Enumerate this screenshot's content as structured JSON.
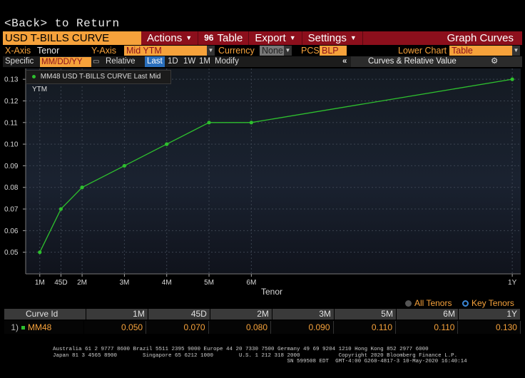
{
  "back_text": "<Back> to Return",
  "menubar": {
    "title": "USD T-BILLS CURVE",
    "actions": "Actions",
    "table_icon": "96",
    "table": "Table",
    "export": "Export",
    "settings": "Settings",
    "graph_curves": "Graph Curves"
  },
  "axisbar": {
    "x_axis_label": "X-Axis",
    "x_axis_value": "Tenor",
    "y_axis_label": "Y-Axis",
    "y_axis_value": "Mid YTM",
    "currency_label": "Currency",
    "currency_value": "None",
    "pcs_label": "PCS",
    "pcs_value": "BLP",
    "lower_chart_label": "Lower Chart",
    "lower_chart_value": "Table"
  },
  "specbar": {
    "specific_label": "Specific",
    "date_placeholder": "MM/DD/YY",
    "relative_label": "Relative",
    "tabs": [
      "Last",
      "1D",
      "1W",
      "1M"
    ],
    "modify": "Modify",
    "collapse": "«",
    "curves_panel": "Curves & Relative Value",
    "gear": "⚙"
  },
  "legend": "MM48 USD T-BILLS CURVE Last Mid YTM",
  "chart_data": {
    "type": "line",
    "categories": [
      "1M",
      "45D",
      "2M",
      "3M",
      "4M",
      "5M",
      "6M",
      "1Y"
    ],
    "x_days": [
      30,
      45,
      60,
      90,
      120,
      150,
      180,
      365
    ],
    "series": [
      {
        "name": "MM48 USD T-BILLS CURVE Last Mid YTM",
        "values": [
          0.05,
          0.07,
          0.08,
          0.09,
          0.1,
          0.11,
          0.11,
          0.13
        ],
        "color": "#2ec02e"
      }
    ],
    "xlabel": "Tenor",
    "ylabel": "",
    "ylim": [
      0.04,
      0.135
    ],
    "yticks": [
      "0.05",
      "0.06",
      "0.07",
      "0.08",
      "0.09",
      "0.10",
      "0.11",
      "0.12",
      "0.13"
    ],
    "grid": true,
    "legend_position": "top-left"
  },
  "tenor_toggle": {
    "all": "All Tenors",
    "key": "Key Tenors"
  },
  "table": {
    "headers": [
      "Curve Id",
      "1M",
      "45D",
      "2M",
      "3M",
      "5M",
      "6M",
      "1Y"
    ],
    "row": {
      "index": "1)",
      "curve": "MM48",
      "values": [
        "0.050",
        "0.070",
        "0.080",
        "0.090",
        "0.110",
        "0.110",
        "0.130"
      ]
    }
  },
  "footer": {
    "line1": "Australia 61 2 9777 8600 Brazil 5511 2395 9000 Europe 44 20 7330 7500 Germany 49 69 9204 1210 Hong Kong 852 2977 6000",
    "line2": "Japan 81 3 4565 8900        Singapore 65 6212 1000        U.S. 1 212 318 2000            Copyright 2020 Bloomberg Finance L.P.",
    "line3": "                                                                         SN 599508 EDT  GMT-4:00 G260-4817-3 10-May-2020 16:40:14"
  },
  "colors": {
    "orange": "#f6a23b",
    "red_bar": "#8c0f1c",
    "line": "#2ec02e",
    "blue": "#2a6fbd"
  }
}
